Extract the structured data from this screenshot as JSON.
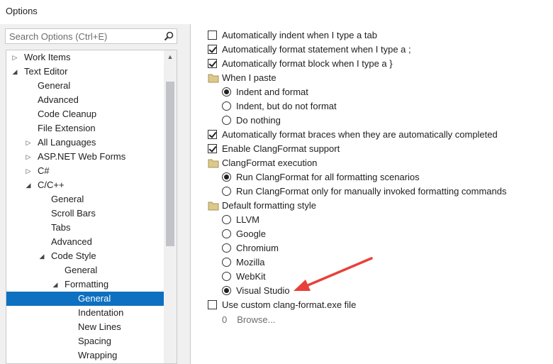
{
  "window": {
    "title": "Options"
  },
  "search": {
    "placeholder": "Search Options (Ctrl+E)"
  },
  "tree": {
    "items": [
      {
        "label": "Work Items",
        "level": 0,
        "expander": "collapsed"
      },
      {
        "label": "Text Editor",
        "level": 0,
        "expander": "expanded"
      },
      {
        "label": "General",
        "level": 1,
        "expander": "none"
      },
      {
        "label": "Advanced",
        "level": 1,
        "expander": "none"
      },
      {
        "label": "Code Cleanup",
        "level": 1,
        "expander": "none"
      },
      {
        "label": "File Extension",
        "level": 1,
        "expander": "none"
      },
      {
        "label": "All Languages",
        "level": 1,
        "expander": "collapsed"
      },
      {
        "label": "ASP.NET Web Forms",
        "level": 1,
        "expander": "collapsed"
      },
      {
        "label": "C#",
        "level": 1,
        "expander": "collapsed"
      },
      {
        "label": "C/C++",
        "level": 1,
        "expander": "expanded"
      },
      {
        "label": "General",
        "level": 2,
        "expander": "none"
      },
      {
        "label": "Scroll Bars",
        "level": 2,
        "expander": "none"
      },
      {
        "label": "Tabs",
        "level": 2,
        "expander": "none"
      },
      {
        "label": "Advanced",
        "level": 2,
        "expander": "none"
      },
      {
        "label": "Code Style",
        "level": 2,
        "expander": "expanded"
      },
      {
        "label": "General",
        "level": 3,
        "expander": "none"
      },
      {
        "label": "Formatting",
        "level": 3,
        "expander": "expanded"
      },
      {
        "label": "General",
        "level": 4,
        "expander": "none",
        "selected": true
      },
      {
        "label": "Indentation",
        "level": 4,
        "expander": "none"
      },
      {
        "label": "New Lines",
        "level": 4,
        "expander": "none"
      },
      {
        "label": "Spacing",
        "level": 4,
        "expander": "none"
      },
      {
        "label": "Wrapping",
        "level": 4,
        "expander": "none"
      }
    ]
  },
  "options": [
    {
      "kind": "checkbox",
      "label": "Automatically indent when I type a tab",
      "checked": false,
      "indent": 0
    },
    {
      "kind": "checkbox",
      "label": "Automatically format statement when I type a ;",
      "checked": true,
      "indent": 0
    },
    {
      "kind": "checkbox",
      "label": "Automatically format block when I type a }",
      "checked": true,
      "indent": 0
    },
    {
      "kind": "group",
      "label": "When I paste",
      "indent": 0
    },
    {
      "kind": "radio",
      "label": "Indent and format",
      "checked": true,
      "indent": 1
    },
    {
      "kind": "radio",
      "label": "Indent, but do not format",
      "checked": false,
      "indent": 1
    },
    {
      "kind": "radio",
      "label": "Do nothing",
      "checked": false,
      "indent": 1
    },
    {
      "kind": "checkbox",
      "label": "Automatically format braces when they are automatically completed",
      "checked": true,
      "indent": 0
    },
    {
      "kind": "checkbox",
      "label": "Enable ClangFormat support",
      "checked": true,
      "indent": 0
    },
    {
      "kind": "group",
      "label": "ClangFormat execution",
      "indent": 0
    },
    {
      "kind": "radio",
      "label": "Run ClangFormat for all formatting scenarios",
      "checked": true,
      "indent": 1
    },
    {
      "kind": "radio",
      "label": "Run ClangFormat only for manually invoked formatting commands",
      "checked": false,
      "indent": 1
    },
    {
      "kind": "group",
      "label": "Default formatting style",
      "indent": 0
    },
    {
      "kind": "radio",
      "label": "LLVM",
      "checked": false,
      "indent": 1
    },
    {
      "kind": "radio",
      "label": "Google",
      "checked": false,
      "indent": 1
    },
    {
      "kind": "radio",
      "label": "Chromium",
      "checked": false,
      "indent": 1
    },
    {
      "kind": "radio",
      "label": "Mozilla",
      "checked": false,
      "indent": 1
    },
    {
      "kind": "radio",
      "label": "WebKit",
      "checked": false,
      "indent": 1
    },
    {
      "kind": "radio",
      "label": "Visual Studio",
      "checked": true,
      "indent": 1
    },
    {
      "kind": "checkbox",
      "label": "Use custom clang-format.exe file",
      "checked": false,
      "indent": 0
    }
  ],
  "custom_path": {
    "value": "0",
    "browse_label": "Browse..."
  },
  "annotation": {
    "color": "#e8403a"
  },
  "colors": {
    "selection": "#0e70c0",
    "folder": "#dcc98a"
  }
}
